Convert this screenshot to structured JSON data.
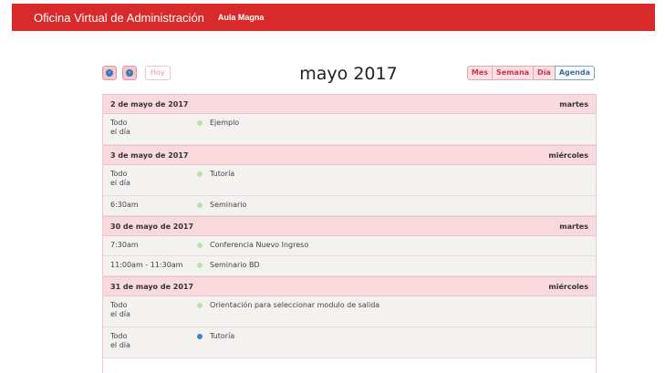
{
  "header": {
    "brand": "Oficina Virtual de Administración",
    "nav_link": "Aula Magna",
    "color": "#d92a2b"
  },
  "toolbar": {
    "prev_icon": "chevron-left-icon",
    "next_icon": "chevron-right-icon",
    "today_label": "Hoy",
    "title": "mayo 2017",
    "views": [
      "Mes",
      "Semana",
      "Día",
      "Agenda"
    ],
    "active_view": "Agenda"
  },
  "days": [
    {
      "date": "2 de mayo de 2017",
      "weekday": "martes",
      "events": [
        {
          "time": "Todo",
          "time2": "el día",
          "title": "Ejemplo",
          "color": "#b9e4a8"
        }
      ]
    },
    {
      "date": "3 de mayo de 2017",
      "weekday": "miércoles",
      "events": [
        {
          "time": "Todo",
          "time2": "el día",
          "title": "Tutoría",
          "color": "#b9e4a8"
        },
        {
          "time": "6:30am",
          "time2": "",
          "title": "Seminario",
          "color": "#b9e4a8"
        }
      ]
    },
    {
      "date": "30 de mayo de 2017",
      "weekday": "martes",
      "events": [
        {
          "time": "7:30am",
          "time2": "",
          "title": "Conferencia Nuevo Ingreso",
          "color": "#b9e4a8"
        },
        {
          "time": "11:00am - 11:30am",
          "time2": "",
          "title": "Seminario BD",
          "color": "#b9e4a8"
        }
      ]
    },
    {
      "date": "31 de mayo de 2017",
      "weekday": "miércoles",
      "events": [
        {
          "time": "Todo",
          "time2": "el día",
          "title": "Orientación para seleccionar modulo de salida",
          "color": "#b9e4a8"
        },
        {
          "time": "Todo",
          "time2": "el día",
          "title": "Tutoría",
          "color": "#3a86c8"
        }
      ]
    }
  ]
}
